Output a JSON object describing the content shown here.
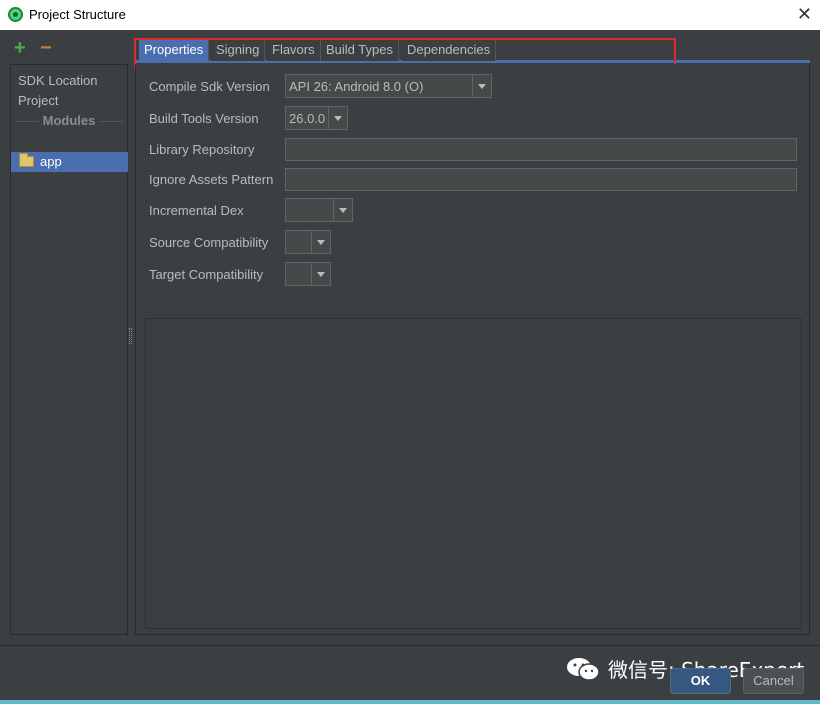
{
  "window": {
    "title": "Project Structure",
    "close_glyph": "✕"
  },
  "sidebar": {
    "toolbar": {
      "add_glyph": "+",
      "remove_glyph": "−"
    },
    "items": [
      {
        "label": "SDK Location"
      },
      {
        "label": "Project"
      }
    ],
    "group_header": "Modules",
    "modules": [
      {
        "label": "app",
        "selected": true
      }
    ]
  },
  "tabs": [
    {
      "label": "Properties",
      "active": true
    },
    {
      "label": "Signing"
    },
    {
      "label": "Flavors"
    },
    {
      "label": "Build Types"
    },
    {
      "label": "Dependencies"
    }
  ],
  "properties": {
    "compile_sdk": {
      "label": "Compile Sdk Version",
      "value": "API 26: Android 8.0 (O)"
    },
    "build_tools": {
      "label": "Build Tools Version",
      "value": "26.0.0"
    },
    "library_repository": {
      "label": "Library Repository",
      "value": ""
    },
    "ignore_assets": {
      "label": "Ignore Assets Pattern",
      "value": ""
    },
    "incremental_dex": {
      "label": "Incremental Dex",
      "value": ""
    },
    "source_compat": {
      "label": "Source Compatibility",
      "value": ""
    },
    "target_compat": {
      "label": "Target Compatibility",
      "value": ""
    }
  },
  "footer": {
    "ok_label": "OK",
    "cancel_label": "Cancel",
    "watermark": "微信号: ShareExpert"
  },
  "colors": {
    "selection": "#4b6eaf",
    "highlight_box": "#e12b2b",
    "background": "#3c3f41"
  }
}
